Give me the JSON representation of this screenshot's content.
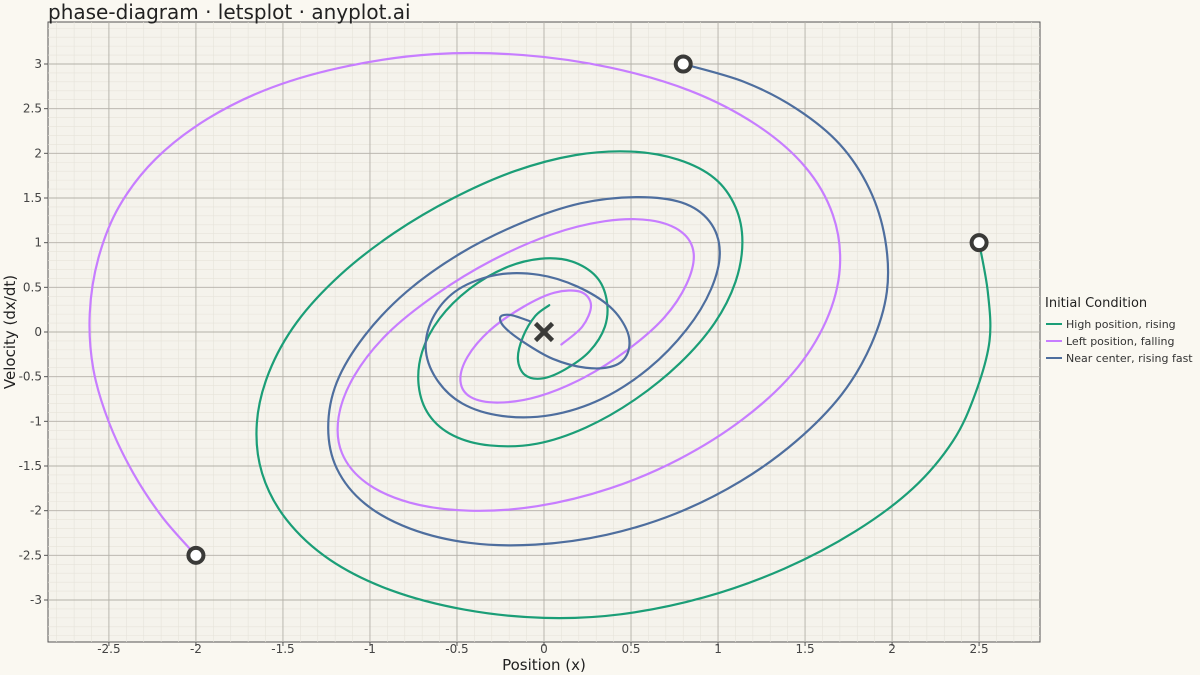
{
  "chart_data": {
    "type": "line",
    "title": "phase-diagram · letsplot · anyplot.ai",
    "xlabel": "Position (x)",
    "ylabel": "Velocity (dx/dt)",
    "xlim": [
      -2.85,
      2.85
    ],
    "ylim": [
      -3.47,
      3.47
    ],
    "x_ticks": [
      -2.5,
      -2,
      -1.5,
      -1,
      -0.5,
      0,
      0.5,
      1,
      1.5,
      2,
      2.5
    ],
    "y_ticks": [
      -3,
      -2.5,
      -2,
      -1.5,
      -1,
      -0.5,
      0,
      0.5,
      1,
      1.5,
      2,
      2.5,
      3
    ],
    "x_tick_labels": [
      "-2.5",
      "-2",
      "-1.5",
      "-1",
      "-0.5",
      "0",
      "0.5",
      "1",
      "1.5",
      "2",
      "2.5"
    ],
    "y_tick_labels": [
      "-3",
      "-2.5",
      "-2",
      "-1.5",
      "-1",
      "-0.5",
      "0",
      "0.5",
      "1",
      "1.5",
      "2",
      "2.5",
      "3"
    ],
    "grid": true,
    "legend": {
      "title": "Initial Condition",
      "position": "right"
    },
    "series": [
      {
        "name": "High position, rising",
        "color": "#1b9e77",
        "x": [
          2.5,
          2.55,
          2.56,
          2.48,
          2.35,
          2.12,
          1.79,
          1.38,
          0.92,
          0.44,
          0.0,
          -0.45,
          -0.88,
          -1.23,
          -1.48,
          -1.62,
          -1.65,
          -1.58,
          -1.42,
          -1.17,
          -0.86,
          -0.52,
          -0.17,
          0.18,
          0.5,
          0.77,
          0.98,
          1.1,
          1.14,
          1.1,
          0.98,
          0.78,
          0.52,
          0.24,
          -0.04,
          -0.31,
          -0.52,
          -0.66,
          -0.72,
          -0.7,
          -0.6,
          -0.43,
          -0.22,
          -0.02,
          0.16,
          0.3,
          0.36,
          0.35,
          0.26,
          0.12,
          -0.01,
          -0.11,
          -0.15,
          -0.12,
          -0.05,
          0.03
        ],
        "y": [
          1.0,
          0.45,
          -0.1,
          -0.68,
          -1.22,
          -1.75,
          -2.23,
          -2.65,
          -2.97,
          -3.16,
          -3.2,
          -3.11,
          -2.89,
          -2.55,
          -2.1,
          -1.58,
          -1.02,
          -0.45,
          0.11,
          0.64,
          1.11,
          1.5,
          1.8,
          1.98,
          2.02,
          1.93,
          1.72,
          1.4,
          1.01,
          0.56,
          0.1,
          -0.35,
          -0.76,
          -1.07,
          -1.25,
          -1.27,
          -1.16,
          -0.93,
          -0.6,
          -0.22,
          0.15,
          0.48,
          0.72,
          0.82,
          0.79,
          0.62,
          0.36,
          0.06,
          -0.22,
          -0.42,
          -0.52,
          -0.48,
          -0.3,
          -0.05,
          0.18,
          0.3
        ]
      },
      {
        "name": "Left position, falling",
        "color": "#c77dff",
        "x": [
          -2.0,
          -2.19,
          -2.36,
          -2.5,
          -2.59,
          -2.61,
          -2.56,
          -2.44,
          -2.23,
          -1.93,
          -1.56,
          -1.12,
          -0.63,
          -0.12,
          0.38,
          0.84,
          1.22,
          1.5,
          1.66,
          1.7,
          1.62,
          1.43,
          1.14,
          0.78,
          0.38,
          -0.04,
          -0.43,
          -0.77,
          -1.02,
          -1.16,
          -1.18,
          -1.09,
          -0.9,
          -0.62,
          -0.3,
          0.04,
          0.35,
          0.61,
          0.79,
          0.86,
          0.82,
          0.69,
          0.48,
          0.23,
          -0.03,
          -0.26,
          -0.42,
          -0.48,
          -0.44,
          -0.31,
          -0.12,
          0.06,
          0.21,
          0.27,
          0.22,
          0.1
        ],
        "y": [
          -2.5,
          -2.08,
          -1.58,
          -1.01,
          -0.41,
          0.21,
          0.83,
          1.41,
          1.94,
          2.39,
          2.74,
          2.98,
          3.11,
          3.1,
          2.96,
          2.7,
          2.32,
          1.85,
          1.31,
          0.72,
          0.12,
          -0.46,
          -0.98,
          -1.42,
          -1.75,
          -1.95,
          -2.0,
          -1.91,
          -1.69,
          -1.36,
          -0.95,
          -0.49,
          -0.02,
          0.42,
          0.8,
          1.09,
          1.24,
          1.25,
          1.12,
          0.88,
          0.54,
          0.16,
          -0.2,
          -0.51,
          -0.72,
          -0.79,
          -0.73,
          -0.55,
          -0.28,
          0.02,
          0.28,
          0.44,
          0.45,
          0.3,
          0.06,
          -0.14
        ]
      },
      {
        "name": "Near center, rising fast",
        "color": "#4e6e9e",
        "x": [
          0.8,
          1.15,
          1.45,
          1.7,
          1.87,
          1.96,
          1.97,
          1.88,
          1.71,
          1.45,
          1.13,
          0.76,
          0.36,
          -0.05,
          -0.43,
          -0.77,
          -1.03,
          -1.19,
          -1.24,
          -1.19,
          -1.03,
          -0.79,
          -0.48,
          -0.13,
          0.21,
          0.53,
          0.79,
          0.95,
          1.01,
          0.96,
          0.82,
          0.6,
          0.33,
          0.04,
          -0.24,
          -0.47,
          -0.62,
          -0.68,
          -0.63,
          -0.49,
          -0.27,
          -0.03,
          0.19,
          0.38,
          0.48,
          0.48,
          0.4,
          0.24,
          0.05,
          -0.12,
          -0.23,
          -0.25,
          -0.19,
          -0.08
        ],
        "y": [
          3.0,
          2.8,
          2.5,
          2.1,
          1.6,
          1.04,
          0.45,
          -0.14,
          -0.7,
          -1.22,
          -1.67,
          -2.03,
          -2.27,
          -2.38,
          -2.36,
          -2.2,
          -1.92,
          -1.53,
          -1.07,
          -0.56,
          -0.04,
          0.45,
          0.88,
          1.22,
          1.44,
          1.51,
          1.45,
          1.24,
          0.9,
          0.48,
          0.03,
          -0.41,
          -0.75,
          -0.93,
          -0.94,
          -0.8,
          -0.52,
          -0.17,
          0.19,
          0.48,
          0.64,
          0.64,
          0.51,
          0.28,
          0.0,
          -0.24,
          -0.38,
          -0.4,
          -0.3,
          -0.11,
          0.06,
          0.17,
          0.19,
          0.12
        ]
      }
    ],
    "start_points": [
      {
        "x": 2.5,
        "y": 1.0
      },
      {
        "x": -2.0,
        "y": -2.5
      },
      {
        "x": 0.8,
        "y": 3.0
      }
    ],
    "equilibrium": {
      "x": 0,
      "y": 0
    }
  }
}
